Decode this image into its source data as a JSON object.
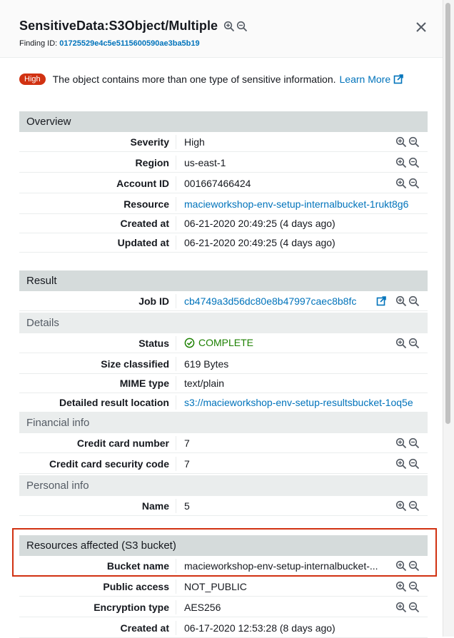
{
  "header": {
    "title": "SensitiveData:S3Object/Multiple",
    "finding_id_label": "Finding ID:",
    "finding_id": "01725529e4c5e5115600590ae3ba5b19"
  },
  "alert": {
    "badge": "High",
    "message": "The object contains more than one type of sensitive information.",
    "learn_more": "Learn More"
  },
  "overview": {
    "heading": "Overview",
    "rows": [
      {
        "label": "Severity",
        "value": "High"
      },
      {
        "label": "Region",
        "value": "us-east-1"
      },
      {
        "label": "Account ID",
        "value": "001667466424"
      },
      {
        "label": "Resource",
        "value": "macieworkshop-env-setup-internalbucket-1rukt8g6"
      },
      {
        "label": "Created at",
        "value": "06-21-2020 20:49:25 (4 days ago)"
      },
      {
        "label": "Updated at",
        "value": "06-21-2020 20:49:25 (4 days ago)"
      }
    ]
  },
  "result": {
    "heading": "Result",
    "job_id_label": "Job ID",
    "job_id": "cb4749a3d56dc80e8b47997caec8b8fc",
    "details_heading": "Details",
    "status_label": "Status",
    "status": "COMPLETE",
    "size_label": "Size classified",
    "size": "619 Bytes",
    "mime_label": "MIME type",
    "mime": "text/plain",
    "location_label": "Detailed result location",
    "location": "s3://macieworkshop-env-setup-resultsbucket-1oq5e",
    "financial_heading": "Financial info",
    "cc_label": "Credit card number",
    "cc": "7",
    "ccv_label": "Credit card security code",
    "ccv": "7",
    "personal_heading": "Personal info",
    "name_label": "Name",
    "name": "5"
  },
  "resources": {
    "heading": "Resources affected (S3 bucket)",
    "rows": [
      {
        "label": "Bucket name",
        "value": "macieworkshop-env-setup-internalbucket-..."
      },
      {
        "label": "Public access",
        "value": "NOT_PUBLIC"
      },
      {
        "label": "Encryption type",
        "value": "AES256"
      },
      {
        "label": "Created at",
        "value": "06-17-2020 12:53:28 (8 days ago)"
      }
    ]
  },
  "colors": {
    "link": "#0073bb",
    "high_badge": "#d13212",
    "complete": "#1d8102",
    "section_header": "#d5dbdb",
    "subsection_header": "#eaeded",
    "highlight_border": "#d13212"
  },
  "icons": [
    "zoom-in-icon",
    "zoom-out-icon",
    "close-icon",
    "external-link-icon",
    "check-circle-icon"
  ]
}
